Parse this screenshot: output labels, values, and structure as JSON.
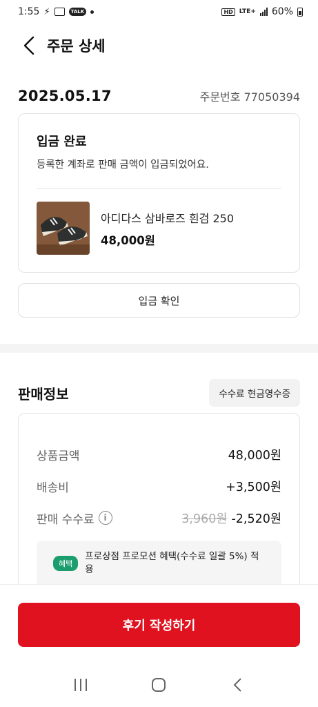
{
  "status_bar": {
    "time": "1:55",
    "talk_badge": "TALK",
    "hd": "HD",
    "network": "LTE+",
    "battery": "60%"
  },
  "header": {
    "title": "주문 상세"
  },
  "order": {
    "date": "2025.05.17",
    "number": "주문번호 77050394"
  },
  "status_card": {
    "title": "입금 완료",
    "description": "등록한 계좌로 판매 금액이 입금되었어요.",
    "product": {
      "name": "아디다스 삼바로즈 흰검 250",
      "price": "48,000원"
    }
  },
  "confirm_button": "입금 확인",
  "sale": {
    "title": "판매정보",
    "receipt_button": "수수료 현금영수증",
    "rows": [
      {
        "label": "상품금액",
        "value": "48,000원"
      },
      {
        "label": "배송비",
        "value": "+3,500원"
      },
      {
        "label": "판매 수수료",
        "original": "3,960원",
        "value": "-2,520원"
      }
    ],
    "benefit": {
      "badge": "혜택",
      "text": "프로상점 프로모션 혜택(수수료 일괄 5%) 적용"
    }
  },
  "review_button": "후기 작성하기",
  "colors": {
    "primary": "#e0121f",
    "benefit_badge": "#1a9e6e"
  }
}
